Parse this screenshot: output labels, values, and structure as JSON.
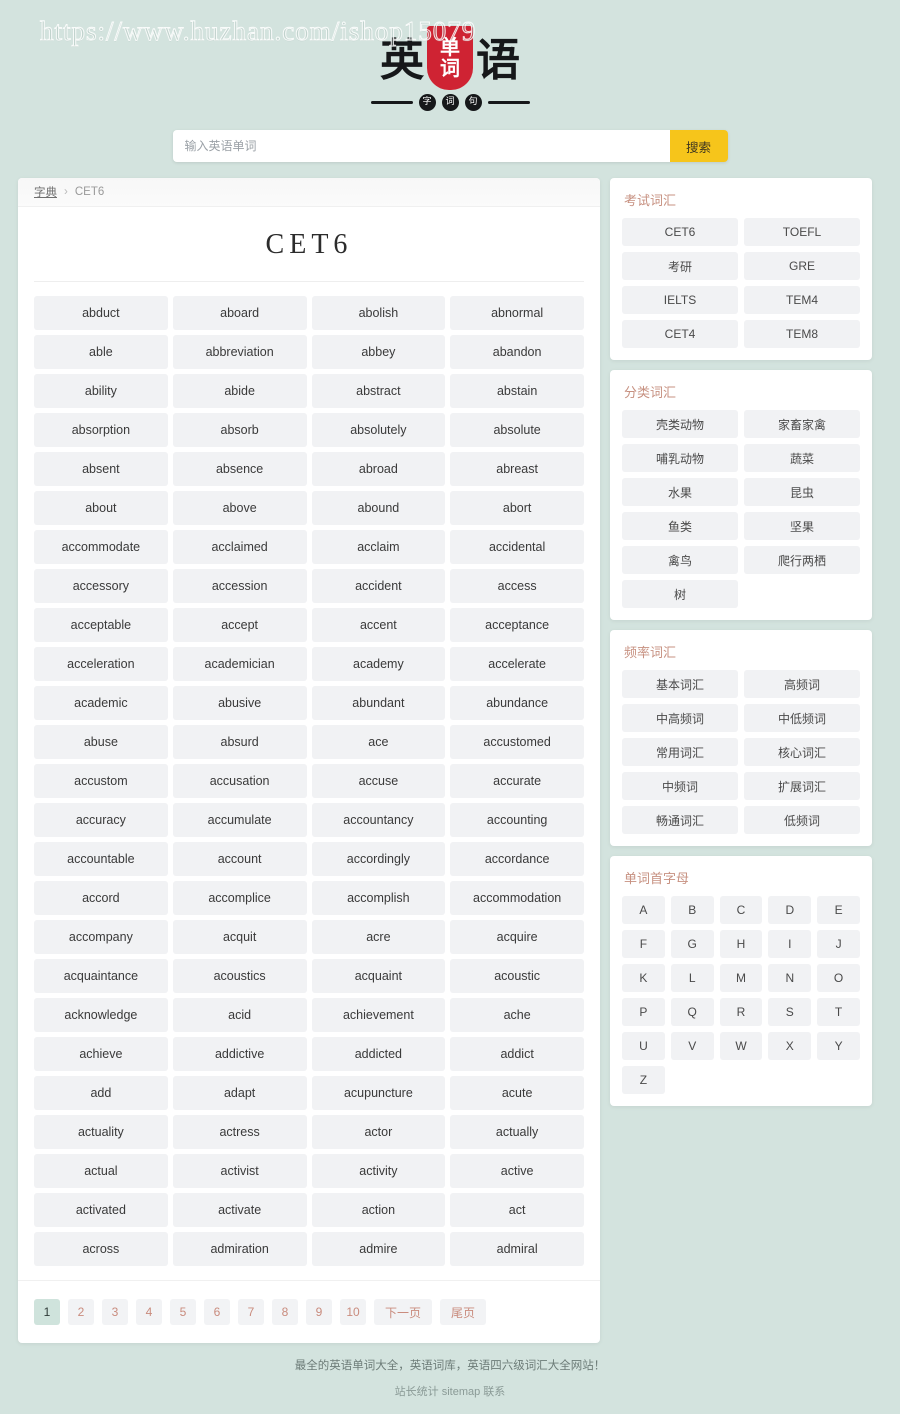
{
  "watermark": "https://www.huzhan.com/ishop15079",
  "logo": {
    "left_char": "英",
    "seal_chars": [
      "单",
      "词"
    ],
    "right_char": "语",
    "sub_dots": [
      "字",
      "词",
      "句"
    ]
  },
  "search": {
    "placeholder": "输入英语单词",
    "value": "",
    "button_label": "搜索"
  },
  "breadcrumb": {
    "root": "字典",
    "separator": "›",
    "current": "CET6"
  },
  "page_title": "CET6",
  "words": [
    "abduct",
    "aboard",
    "abolish",
    "abnormal",
    "able",
    "abbreviation",
    "abbey",
    "abandon",
    "ability",
    "abide",
    "abstract",
    "abstain",
    "absorption",
    "absorb",
    "absolutely",
    "absolute",
    "absent",
    "absence",
    "abroad",
    "abreast",
    "about",
    "above",
    "abound",
    "abort",
    "accommodate",
    "acclaimed",
    "acclaim",
    "accidental",
    "accessory",
    "accession",
    "accident",
    "access",
    "acceptable",
    "accept",
    "accent",
    "acceptance",
    "acceleration",
    "academician",
    "academy",
    "accelerate",
    "academic",
    "abusive",
    "abundant",
    "abundance",
    "abuse",
    "absurd",
    "ace",
    "accustomed",
    "accustom",
    "accusation",
    "accuse",
    "accurate",
    "accuracy",
    "accumulate",
    "accountancy",
    "accounting",
    "accountable",
    "account",
    "accordingly",
    "accordance",
    "accord",
    "accomplice",
    "accomplish",
    "accommodation",
    "accompany",
    "acquit",
    "acre",
    "acquire",
    "acquaintance",
    "acoustics",
    "acquaint",
    "acoustic",
    "acknowledge",
    "acid",
    "achievement",
    "ache",
    "achieve",
    "addictive",
    "addicted",
    "addict",
    "add",
    "adapt",
    "acupuncture",
    "acute",
    "actuality",
    "actress",
    "actor",
    "actually",
    "actual",
    "activist",
    "activity",
    "active",
    "activated",
    "activate",
    "action",
    "act",
    "across",
    "admiration",
    "admire",
    "admiral"
  ],
  "pagination": {
    "pages": [
      "1",
      "2",
      "3",
      "4",
      "5",
      "6",
      "7",
      "8",
      "9",
      "10"
    ],
    "active": "1",
    "next_label": "下一页",
    "last_label": "尾页"
  },
  "sidebar": {
    "exam": {
      "title": "考试词汇",
      "items": [
        "CET6",
        "TOEFL",
        "考研",
        "GRE",
        "IELTS",
        "TEM4",
        "CET4",
        "TEM8"
      ]
    },
    "category": {
      "title": "分类词汇",
      "items": [
        "壳类动物",
        "家畜家禽",
        "哺乳动物",
        "蔬菜",
        "水果",
        "昆虫",
        "鱼类",
        "坚果",
        "禽鸟",
        "爬行两栖",
        "树"
      ]
    },
    "frequency": {
      "title": "频率词汇",
      "items": [
        "基本词汇",
        "高频词",
        "中高频词",
        "中低频词",
        "常用词汇",
        "核心词汇",
        "中频词",
        "扩展词汇",
        "畅通词汇",
        "低频词"
      ]
    },
    "letters": {
      "title": "单词首字母",
      "items": [
        "A",
        "B",
        "C",
        "D",
        "E",
        "F",
        "G",
        "H",
        "I",
        "J",
        "K",
        "L",
        "M",
        "N",
        "O",
        "P",
        "Q",
        "R",
        "S",
        "T",
        "U",
        "V",
        "W",
        "X",
        "Y",
        "Z"
      ]
    }
  },
  "footer": {
    "line1": "最全的英语单词大全，英语词库，英语四六级词汇大全网站！",
    "line2": "站长统计  sitemap  联系"
  },
  "colors": {
    "page_background": "#d3e3de",
    "accent_rose": "#c79181",
    "search_button": "#f6c51b",
    "seal_red": "#cf2333",
    "chip_background": "#f1f2f4",
    "active_page": "#cfe3dc"
  }
}
